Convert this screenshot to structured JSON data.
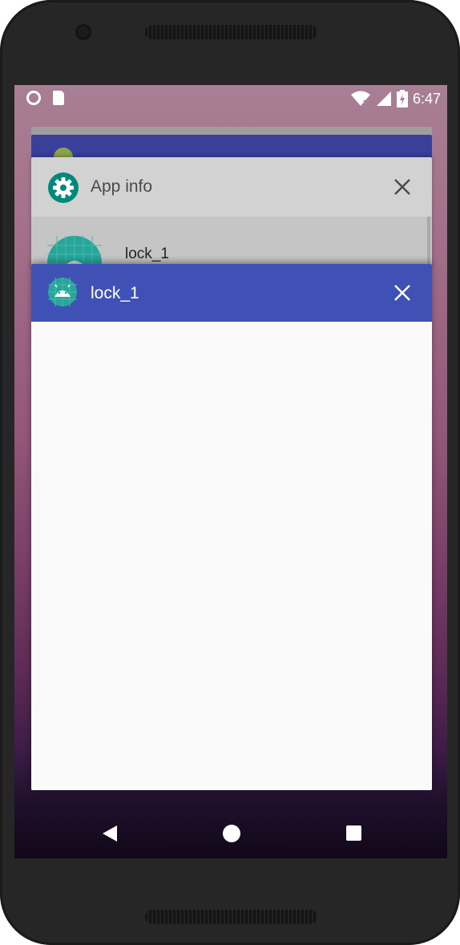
{
  "status_bar": {
    "time": "6:47",
    "left_icons": [
      "record-circle-icon",
      "sd-card-icon"
    ],
    "right_icons": [
      "wifi-icon",
      "cellular-signal-icon",
      "battery-charging-icon"
    ]
  },
  "recents": {
    "app_info_card": {
      "title": "App info",
      "icon": "settings-gear-icon",
      "app_name": "lock_1",
      "accent_color": "#00897b"
    },
    "main_card": {
      "title": "lock_1",
      "icon": "android-icon",
      "header_color": "#3f51b5"
    }
  },
  "nav_bar": {
    "icons": [
      "back-icon",
      "home-icon",
      "recents-icon"
    ]
  }
}
